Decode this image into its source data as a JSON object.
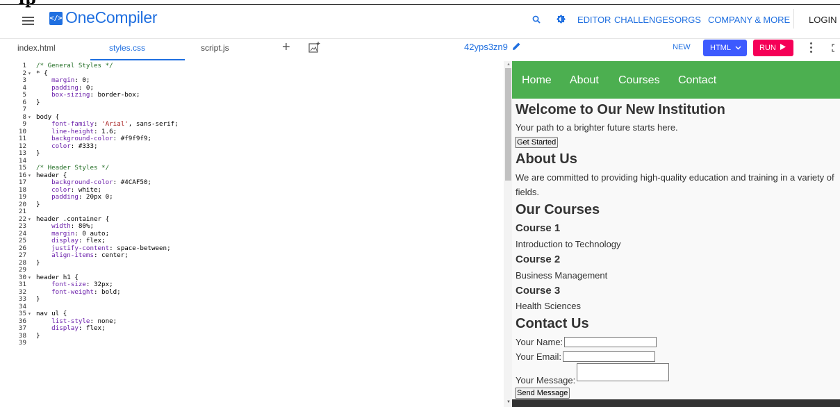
{
  "stray_heading": "Ip",
  "topbar": {
    "brand": "OneCompiler",
    "logo_glyph": "</>",
    "nav": [
      "EDITOR",
      "CHALLENGES",
      "ORGS",
      "COMPANY & MORE"
    ],
    "login": "LOGIN"
  },
  "tabs": [
    {
      "label": "index.html",
      "active": false
    },
    {
      "label": "styles.css",
      "active": true
    },
    {
      "label": "script.js",
      "active": false
    }
  ],
  "toolbar": {
    "plus": "+",
    "project_name": "42yps3zn9",
    "new_label": "NEW",
    "lang_label": "HTML",
    "run_label": "RUN"
  },
  "code_lines": [
    {
      "n": "1",
      "fold": false,
      "text": "/* General Styles */",
      "kind": "comment"
    },
    {
      "n": "2",
      "fold": true,
      "text": "* {",
      "kind": "plain"
    },
    {
      "n": "3",
      "fold": false,
      "text": "    margin: 0;",
      "kind": "prop"
    },
    {
      "n": "4",
      "fold": false,
      "text": "    padding: 0;",
      "kind": "prop"
    },
    {
      "n": "5",
      "fold": false,
      "text": "    box-sizing: border-box;",
      "kind": "prop"
    },
    {
      "n": "6",
      "fold": false,
      "text": "}",
      "kind": "plain"
    },
    {
      "n": "7",
      "fold": false,
      "text": "",
      "kind": "plain"
    },
    {
      "n": "8",
      "fold": true,
      "text": "body {",
      "kind": "plain"
    },
    {
      "n": "9",
      "fold": false,
      "text": "    font-family: 'Arial', sans-serif;",
      "kind": "prop"
    },
    {
      "n": "10",
      "fold": false,
      "text": "    line-height: 1.6;",
      "kind": "prop"
    },
    {
      "n": "11",
      "fold": false,
      "text": "    background-color: #f9f9f9;",
      "kind": "prop"
    },
    {
      "n": "12",
      "fold": false,
      "text": "    color: #333;",
      "kind": "prop"
    },
    {
      "n": "13",
      "fold": false,
      "text": "}",
      "kind": "plain"
    },
    {
      "n": "14",
      "fold": false,
      "text": "",
      "kind": "plain"
    },
    {
      "n": "15",
      "fold": false,
      "text": "/* Header Styles */",
      "kind": "comment"
    },
    {
      "n": "16",
      "fold": true,
      "text": "header {",
      "kind": "plain"
    },
    {
      "n": "17",
      "fold": false,
      "text": "    background-color: #4CAF50;",
      "kind": "prop"
    },
    {
      "n": "18",
      "fold": false,
      "text": "    color: white;",
      "kind": "prop"
    },
    {
      "n": "19",
      "fold": false,
      "text": "    padding: 20px 0;",
      "kind": "prop"
    },
    {
      "n": "20",
      "fold": false,
      "text": "}",
      "kind": "plain"
    },
    {
      "n": "21",
      "fold": false,
      "text": "",
      "kind": "plain"
    },
    {
      "n": "22",
      "fold": true,
      "text": "header .container {",
      "kind": "plain"
    },
    {
      "n": "23",
      "fold": false,
      "text": "    width: 80%;",
      "kind": "prop"
    },
    {
      "n": "24",
      "fold": false,
      "text": "    margin: 0 auto;",
      "kind": "prop"
    },
    {
      "n": "25",
      "fold": false,
      "text": "    display: flex;",
      "kind": "prop"
    },
    {
      "n": "26",
      "fold": false,
      "text": "    justify-content: space-between;",
      "kind": "prop"
    },
    {
      "n": "27",
      "fold": false,
      "text": "    align-items: center;",
      "kind": "prop"
    },
    {
      "n": "28",
      "fold": false,
      "text": "}",
      "kind": "plain"
    },
    {
      "n": "29",
      "fold": false,
      "text": "",
      "kind": "plain"
    },
    {
      "n": "30",
      "fold": true,
      "text": "header h1 {",
      "kind": "plain"
    },
    {
      "n": "31",
      "fold": false,
      "text": "    font-size: 32px;",
      "kind": "prop"
    },
    {
      "n": "32",
      "fold": false,
      "text": "    font-weight: bold;",
      "kind": "prop"
    },
    {
      "n": "33",
      "fold": false,
      "text": "}",
      "kind": "plain"
    },
    {
      "n": "34",
      "fold": false,
      "text": "",
      "kind": "plain"
    },
    {
      "n": "35",
      "fold": true,
      "text": "nav ul {",
      "kind": "plain"
    },
    {
      "n": "36",
      "fold": false,
      "text": "    list-style: none;",
      "kind": "prop"
    },
    {
      "n": "37",
      "fold": false,
      "text": "    display: flex;",
      "kind": "prop"
    },
    {
      "n": "38",
      "fold": false,
      "text": "}",
      "kind": "plain"
    },
    {
      "n": "39",
      "fold": false,
      "text": "",
      "kind": "plain"
    }
  ],
  "preview": {
    "nav": [
      "Home",
      "About",
      "Courses",
      "Contact"
    ],
    "welcome_title": "Welcome to Our New Institution",
    "welcome_text": "Your path to a brighter future starts here.",
    "get_started": "Get Started",
    "about_title": "About Us",
    "about_line1": "We are committed to providing high-quality education and training in a variety of",
    "about_line2": "fields.",
    "courses_title": "Our Courses",
    "courses": [
      {
        "title": "Course 1",
        "desc": "Introduction to Technology"
      },
      {
        "title": "Course 2",
        "desc": "Business Management"
      },
      {
        "title": "Course 3",
        "desc": "Health Sciences"
      }
    ],
    "contact_title": "Contact Us",
    "name_label": "Your Name:",
    "email_label": "Your Email:",
    "message_label": "Your Message:",
    "send_button": "Send Message"
  },
  "colors": {
    "brand_blue": "#1f6fe0",
    "html_button": "#3d5afe",
    "run_button": "#f50057",
    "preview_header": "#4caf50"
  }
}
